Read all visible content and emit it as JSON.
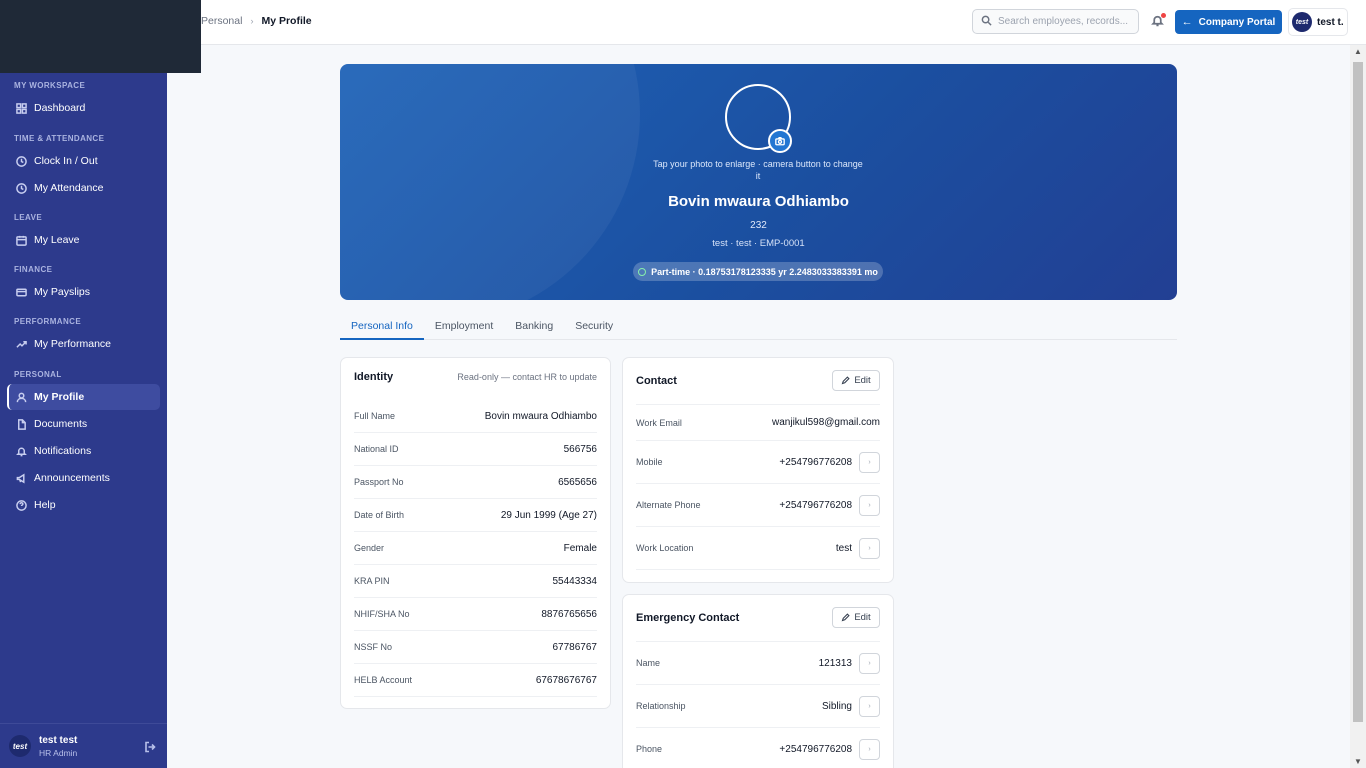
{
  "topbar": {
    "breadcrumb_parent": "Personal",
    "breadcrumb_current": "My Profile",
    "search_placeholder": "Search employees, records...",
    "portal_label": "Company Portal",
    "account_initials": "test",
    "account_name": "test t."
  },
  "sidebar": {
    "sections": [
      {
        "label": "MY WORKSPACE",
        "items": [
          {
            "label": "Dashboard",
            "icon": "grid-icon"
          }
        ]
      },
      {
        "label": "TIME & ATTENDANCE",
        "items": [
          {
            "label": "Clock In / Out",
            "icon": "clock-icon"
          },
          {
            "label": "My Attendance",
            "icon": "clock-icon"
          }
        ]
      },
      {
        "label": "LEAVE",
        "items": [
          {
            "label": "My Leave",
            "icon": "calendar-icon"
          }
        ]
      },
      {
        "label": "FINANCE",
        "items": [
          {
            "label": "My Payslips",
            "icon": "card-icon"
          }
        ]
      },
      {
        "label": "PERFORMANCE",
        "items": [
          {
            "label": "My Performance",
            "icon": "trend-icon"
          }
        ]
      },
      {
        "label": "PERSONAL",
        "items": [
          {
            "label": "My Profile",
            "icon": "user-icon",
            "active": true
          },
          {
            "label": "Documents",
            "icon": "document-icon"
          },
          {
            "label": "Notifications",
            "icon": "bell-icon"
          },
          {
            "label": "Announcements",
            "icon": "megaphone-icon"
          },
          {
            "label": "Help",
            "icon": "help-icon"
          }
        ]
      }
    ],
    "user": {
      "initials": "test",
      "name": "test test",
      "role": "HR Admin"
    }
  },
  "hero": {
    "hint": "Tap your photo to enlarge · camera button to change it",
    "name": "Bovin mwaura Odhiambo",
    "number": "232",
    "meta": "test · test · EMP-0001",
    "pill": "Part-time · 0.18753178123335 yr 2.2483033383391 mo"
  },
  "tabs": [
    "Personal Info",
    "Employment",
    "Banking",
    "Security"
  ],
  "identity": {
    "title": "Identity",
    "note": "Read-only — contact HR to update",
    "rows": [
      {
        "label": "Full Name",
        "value": "Bovin mwaura Odhiambo"
      },
      {
        "label": "National ID",
        "value": "566756"
      },
      {
        "label": "Passport No",
        "value": "6565656"
      },
      {
        "label": "Date of Birth",
        "value": "29 Jun 1999 (Age 27)"
      },
      {
        "label": "Gender",
        "value": "Female"
      },
      {
        "label": "KRA PIN",
        "value": "55443334"
      },
      {
        "label": "NHIF/SHA No",
        "value": "8876765656"
      },
      {
        "label": "NSSF No",
        "value": "67786767"
      },
      {
        "label": "HELB Account",
        "value": "67678676767"
      }
    ]
  },
  "contact": {
    "title": "Contact",
    "edit_label": "Edit",
    "rows": [
      {
        "label": "Work Email",
        "value": "wanjikul598@gmail.com"
      },
      {
        "label": "Mobile",
        "value": "+254796776208"
      },
      {
        "label": "Alternate Phone",
        "value": "+254796776208"
      },
      {
        "label": "Work Location",
        "value": "test"
      }
    ]
  },
  "emergency": {
    "title": "Emergency Contact",
    "edit_label": "Edit",
    "rows": [
      {
        "label": "Name",
        "value": "121313"
      },
      {
        "label": "Relationship",
        "value": "Sibling"
      },
      {
        "label": "Phone",
        "value": "+254796776208"
      }
    ]
  },
  "colors": {
    "sidebar": "#2d3a8c",
    "accent": "#1565c0",
    "hero": "#1b4fa0"
  }
}
